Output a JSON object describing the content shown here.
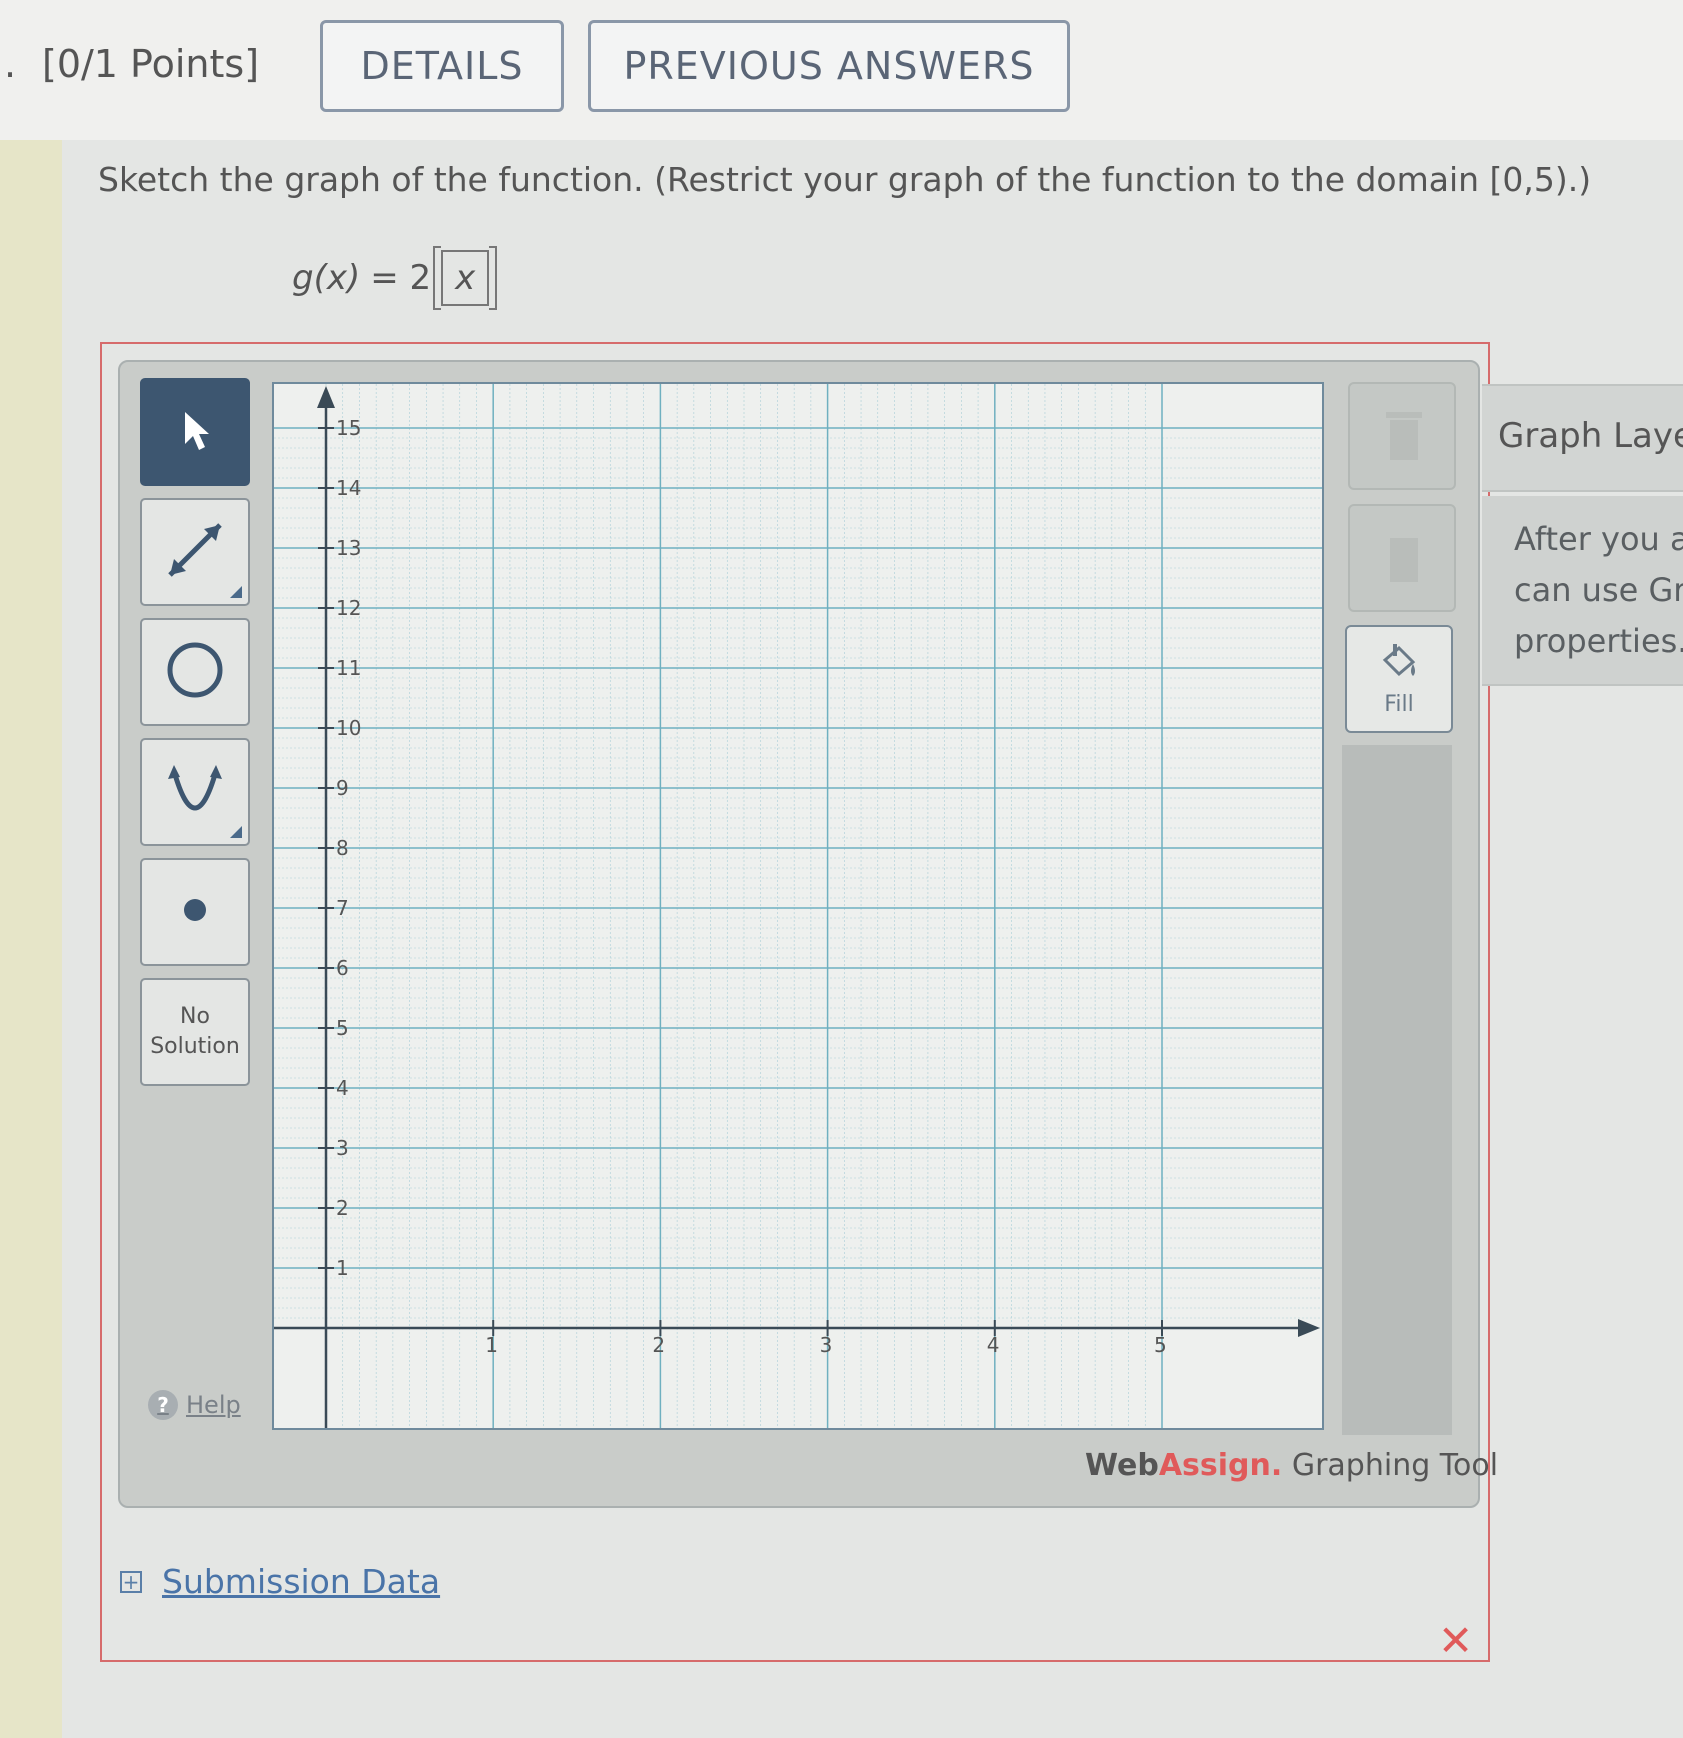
{
  "header": {
    "question_number_suffix": ".",
    "points": "[0/1 Points]",
    "details_label": "DETAILS",
    "previous_answers_label": "PREVIOUS ANSWERS"
  },
  "question": {
    "prompt": "Sketch the graph of the function. (Restrict your graph of the function to the domain [0,5).)",
    "formula_lhs": "g(x)",
    "formula_eq": "= 2",
    "formula_var": "x"
  },
  "toolbar": {
    "tools": [
      {
        "name": "select-tool",
        "icon": "pointer-arrow-icon",
        "active": true
      },
      {
        "name": "line-tool",
        "icon": "line-icon",
        "active": false
      },
      {
        "name": "circle-tool",
        "icon": "circle-icon",
        "active": false
      },
      {
        "name": "parabola-tool",
        "icon": "parabola-icon",
        "active": false
      },
      {
        "name": "point-tool",
        "icon": "point-icon",
        "active": false
      }
    ],
    "no_solution_line1": "No",
    "no_solution_line2": "Solution",
    "help_label": "Help"
  },
  "graph": {
    "x_range": [
      0,
      5
    ],
    "y_range": [
      0,
      15
    ],
    "x_ticks": [
      "1",
      "2",
      "3",
      "4",
      "5"
    ],
    "y_ticks": [
      "1",
      "2",
      "3",
      "4",
      "5",
      "6",
      "7",
      "8",
      "9",
      "10",
      "11",
      "12",
      "13",
      "14",
      "15"
    ],
    "grid_color": "#6fb0c0",
    "minor_grid_color": "#a9cdd6"
  },
  "right_tools": {
    "fill_label": "Fill"
  },
  "brand": {
    "web": "Web",
    "assign": "Assign.",
    "suffix": " Graphing Tool"
  },
  "layers": {
    "title": "Graph Layers",
    "line1": "After you add an object to the graph you",
    "line2": "can use Graph Layers to view and edit its",
    "line3": "properties."
  },
  "submission": {
    "expand_symbol": "+",
    "label": "Submission Data"
  },
  "status": {
    "incorrect_mark": "✕",
    "incorrect_color": "#e05a5a"
  }
}
